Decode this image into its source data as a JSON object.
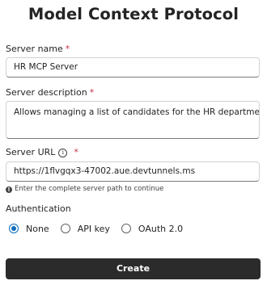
{
  "title": "Model Context Protocol",
  "server_name": {
    "label": "Server name",
    "required_mark": "*",
    "value": "HR MCP Server"
  },
  "server_description": {
    "label": "Server description",
    "required_mark": "*",
    "value": "Allows managing a list of candidates for the HR department"
  },
  "server_url": {
    "label": "Server URL",
    "info_icon": "info-icon",
    "info_glyph": "i",
    "required_mark": "*",
    "value": "https://1flvgqx3-47002.aue.devtunnels.ms",
    "hint_icon": "info-filled-icon",
    "hint_glyph": "!",
    "hint": "Enter the complete server path to continue"
  },
  "authentication": {
    "label": "Authentication",
    "options": [
      {
        "label": "None",
        "checked": true
      },
      {
        "label": "API key",
        "checked": false
      },
      {
        "label": "OAuth 2.0",
        "checked": false
      }
    ]
  },
  "create_button": {
    "label": "Create"
  },
  "colors": {
    "accent": "#0f6cbd",
    "required": "#c4314b",
    "button_bg": "#2b2b2b"
  }
}
